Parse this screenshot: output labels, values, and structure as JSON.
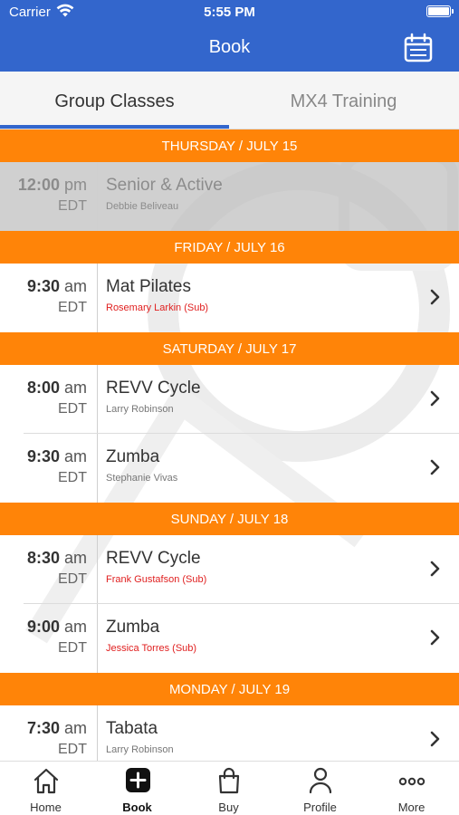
{
  "status_bar": {
    "carrier": "Carrier",
    "time": "5:55 PM"
  },
  "nav": {
    "title": "Book",
    "calendar_icon": "calendar-icon"
  },
  "tabs": [
    {
      "label": "Group Classes",
      "active": true
    },
    {
      "label": "MX4 Training",
      "active": false
    }
  ],
  "days": [
    {
      "header": "THURSDAY / JULY 15"
    },
    {
      "header": "FRIDAY / JULY 16"
    },
    {
      "header": "SATURDAY / JULY 17"
    },
    {
      "header": "SUNDAY / JULY 18"
    },
    {
      "header": "MONDAY / JULY 19"
    }
  ],
  "classes": [
    {
      "time": "12:00",
      "ampm": "pm",
      "tz": "EDT",
      "name": "Senior & Active",
      "instructor": "Debbie Beliveau",
      "sub": false,
      "past": true
    },
    {
      "time": "9:30",
      "ampm": "am",
      "tz": "EDT",
      "name": "Mat Pilates",
      "instructor": "Rosemary Larkin (Sub)",
      "sub": true,
      "past": false
    },
    {
      "time": "8:00",
      "ampm": "am",
      "tz": "EDT",
      "name": "REVV Cycle",
      "instructor": "Larry Robinson",
      "sub": false,
      "past": false
    },
    {
      "time": "9:30",
      "ampm": "am",
      "tz": "EDT",
      "name": "Zumba",
      "instructor": "Stephanie Vivas",
      "sub": false,
      "past": false
    },
    {
      "time": "8:30",
      "ampm": "am",
      "tz": "EDT",
      "name": "REVV Cycle",
      "instructor": "Frank Gustafson (Sub)",
      "sub": true,
      "past": false
    },
    {
      "time": "9:00",
      "ampm": "am",
      "tz": "EDT",
      "name": "Zumba",
      "instructor": "Jessica Torres (Sub)",
      "sub": true,
      "past": false
    },
    {
      "time": "7:30",
      "ampm": "am",
      "tz": "EDT",
      "name": "Tabata",
      "instructor": "Larry Robinson",
      "sub": false,
      "past": false
    }
  ],
  "tab_bar": [
    {
      "label": "Home",
      "icon": "home-icon"
    },
    {
      "label": "Book",
      "icon": "plus-square-icon",
      "active": true
    },
    {
      "label": "Buy",
      "icon": "shopping-bag-icon"
    },
    {
      "label": "Profile",
      "icon": "person-icon"
    },
    {
      "label": "More",
      "icon": "more-dots-icon"
    }
  ],
  "colors": {
    "brand_blue": "#3366cc",
    "day_header_orange": "#ff8408",
    "sub_red": "#e02020"
  }
}
